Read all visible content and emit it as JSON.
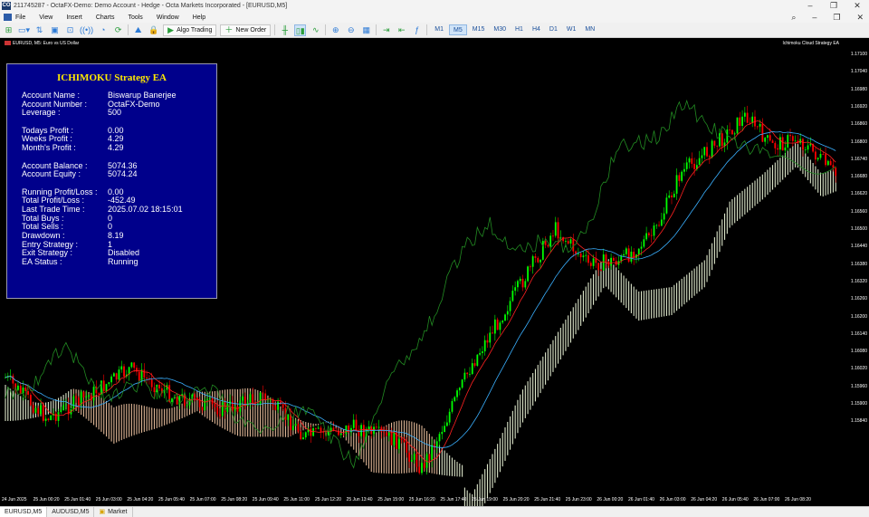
{
  "window": {
    "title": "211745287 - OctaFX-Demo: Demo Account - Hedge - Octa Markets Incorporated - [EURUSD,M5]",
    "logo": "CO"
  },
  "menu": {
    "items": [
      "File",
      "View",
      "Insert",
      "Charts",
      "Tools",
      "Window",
      "Help"
    ]
  },
  "toolbar": {
    "algo_trading": "Algo Trading",
    "new_order": "New Order",
    "timeframes": [
      "M1",
      "M5",
      "M15",
      "M30",
      "H1",
      "H4",
      "D1",
      "W1",
      "MN"
    ],
    "active_timeframe": "M5"
  },
  "chart": {
    "symbol_label": "EURUSD, M5:  Euro vs US Dollar",
    "ea_label": "Ichimoku Cloud Strategy EA",
    "price_labels": [
      "1.17100",
      "1.17040",
      "1.16980",
      "1.16920",
      "1.16860",
      "1.16800",
      "1.16740",
      "1.16680",
      "1.16620",
      "1.16560",
      "1.16500",
      "1.16440",
      "1.16380",
      "1.16320",
      "1.16260",
      "1.16200",
      "1.16140",
      "1.16080",
      "1.16020",
      "1.15960",
      "1.15900",
      "1.15840"
    ],
    "time_labels": [
      "24 Jun 2025",
      "25 Jun 00:20",
      "25 Jun 01:40",
      "25 Jun 03:00",
      "25 Jun 04:20",
      "25 Jun 05:40",
      "25 Jun 07:00",
      "25 Jun 08:20",
      "25 Jun 09:40",
      "25 Jun 11:00",
      "25 Jun 12:20",
      "25 Jun 13:40",
      "25 Jun 15:00",
      "25 Jun 16:20",
      "25 Jun 17:40",
      "25 Jun 19:00",
      "25 Jun 20:20",
      "25 Jun 21:40",
      "25 Jun 23:00",
      "26 Jun 00:20",
      "26 Jun 01:40",
      "26 Jun 03:00",
      "26 Jun 04:20",
      "26 Jun 05:40",
      "26 Jun 07:00",
      "26 Jun 08:20"
    ],
    "colors": {
      "bull": "#00ff00",
      "bear": "#ff0000",
      "tenkan": "#ff2020",
      "kijun": "#3ab0ff",
      "chikou": "#228b22",
      "cloud_bull": "#f5ffe0",
      "cloud_bear": "#f6c9a6"
    }
  },
  "panel": {
    "title": "ICHIMOKU Strategy EA",
    "rows": [
      {
        "k": "Account Name :",
        "v": "Biswarup Banerjee"
      },
      {
        "k": "Account Number :",
        "v": "OctaFX-Demo"
      },
      {
        "k": "Leverage :",
        "v": "500"
      },
      {
        "k": "",
        "v": ""
      },
      {
        "k": "Todays Profit :",
        "v": "0.00"
      },
      {
        "k": "Weeks Profit :",
        "v": "4.29"
      },
      {
        "k": "Month's Profit :",
        "v": "4.29"
      },
      {
        "k": "",
        "v": ""
      },
      {
        "k": "Account Balance :",
        "v": "5074.36"
      },
      {
        "k": "Account Equity :",
        "v": "5074.24"
      },
      {
        "k": "",
        "v": ""
      },
      {
        "k": "Running Profit/Loss :",
        "v": "0.00"
      },
      {
        "k": "Total Profit/Loss :",
        "v": "-452.49"
      },
      {
        "k": "Last Trade Time :",
        "v": "2025.07.02 18:15:01"
      },
      {
        "k": "Total Buys :",
        "v": "0"
      },
      {
        "k": "Total Sells :",
        "v": "0"
      },
      {
        "k": "Drawdown :",
        "v": "8.19"
      },
      {
        "k": "Entry Strategy :",
        "v": "1"
      },
      {
        "k": "Exit Strategy :",
        "v": "Disabled"
      },
      {
        "k": "EA Status :",
        "v": "Running"
      }
    ]
  },
  "tabs": {
    "items": [
      "EURUSD,M5",
      "AUDUSD,M5",
      "Market"
    ],
    "active": "EURUSD,M5"
  }
}
